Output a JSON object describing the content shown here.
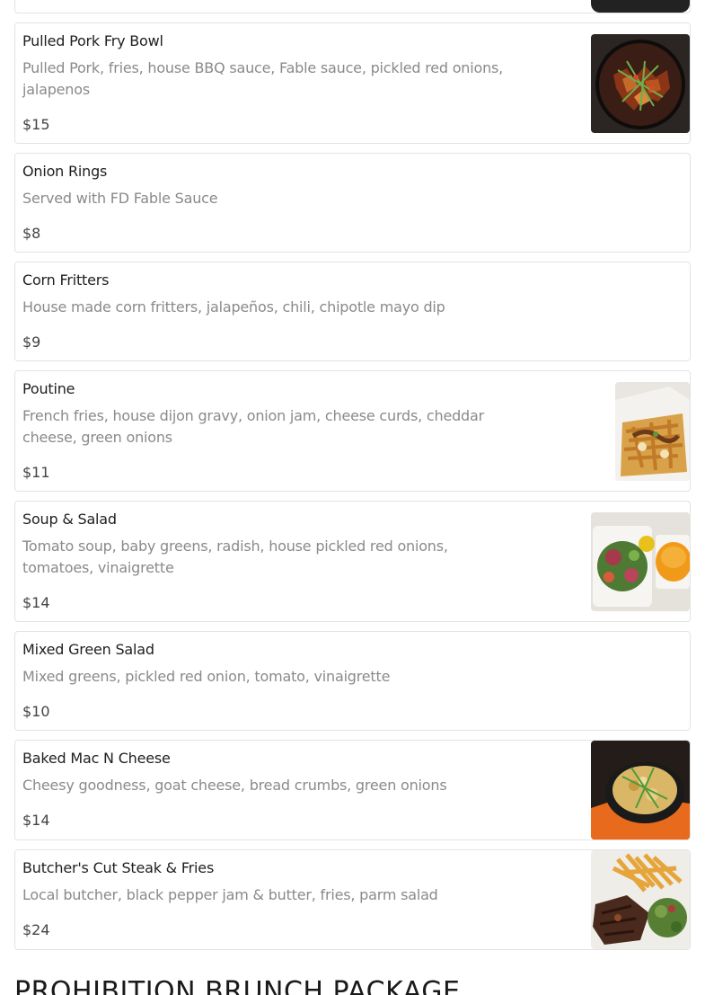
{
  "menu": {
    "items": [
      {
        "name": "Pulled Pork Fry Bowl",
        "description": "Pulled Pork, fries, house BBQ sauce, Fable sauce, pickled red onions, jalapenos",
        "price": "$15",
        "image": "pulled-pork-fry-bowl-photo"
      },
      {
        "name": "Onion Rings",
        "description": "Served with FD Fable Sauce",
        "price": "$8"
      },
      {
        "name": "Corn Fritters",
        "description": "House made corn fritters, jalapeños, chili, chipotle mayo dip",
        "price": "$9"
      },
      {
        "name": "Poutine",
        "description": "French fries, house dijon gravy, onion jam, cheese curds, cheddar cheese, green onions",
        "price": "$11",
        "image": "poutine-photo"
      },
      {
        "name": "Soup & Salad",
        "description": "Tomato soup, baby greens, radish, house pickled red onions, tomatoes, vinaigrette",
        "price": "$14",
        "image": "soup-salad-photo"
      },
      {
        "name": "Mixed Green Salad",
        "description": "Mixed greens, pickled red onion, tomato, vinaigrette",
        "price": "$10"
      },
      {
        "name": "Baked Mac N Cheese",
        "description": "Cheesy goodness, goat cheese, bread crumbs, green onions",
        "price": "$14",
        "image": "mac-n-cheese-photo"
      },
      {
        "name": "Butcher's Cut Steak & Fries",
        "description": "Local butcher, black pepper jam & butter, fries, parm salad",
        "price": "$24",
        "image": "steak-fries-photo"
      }
    ]
  },
  "next_section": {
    "title": "PROHIBITION BRUNCH PACKAGE"
  }
}
